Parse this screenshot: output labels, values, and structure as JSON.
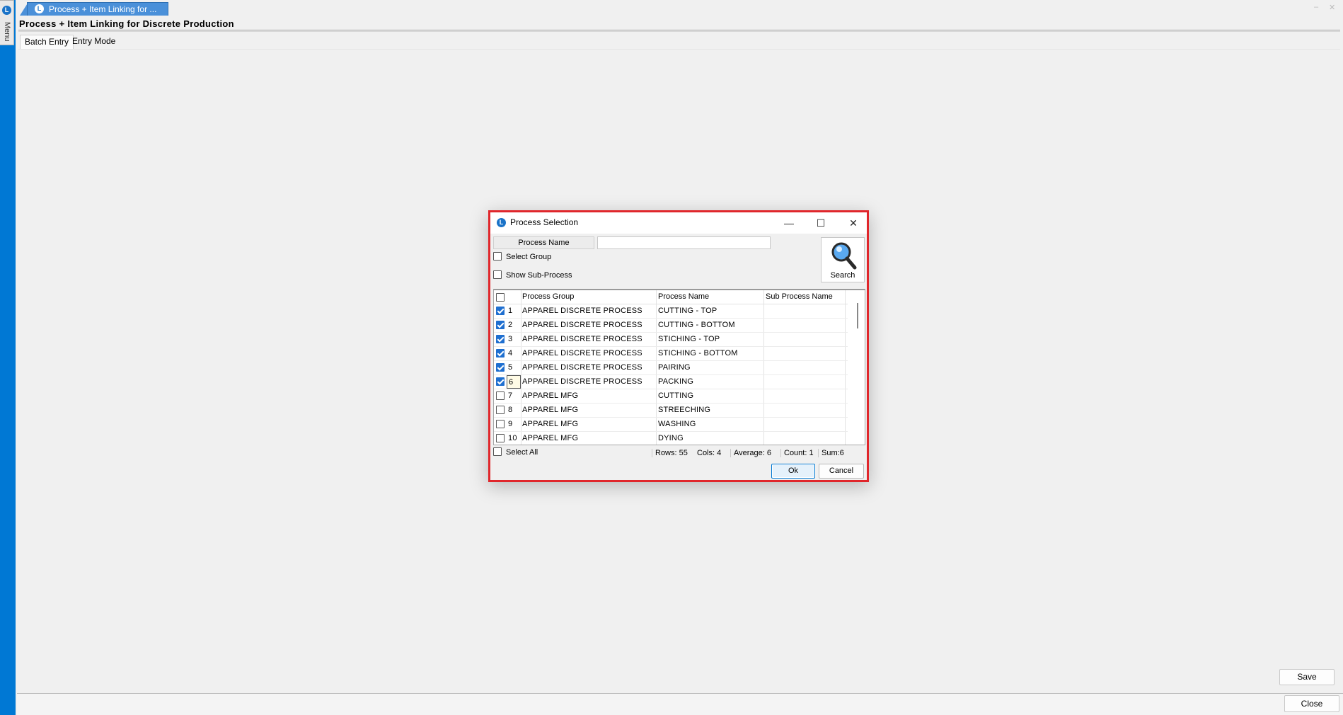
{
  "app": {
    "side_menu_label": "Menu",
    "logo_letter": "L",
    "doc_tab_title": "Process + Item Linking for ...",
    "page_title": "Process + Item Linking for Discrete Production",
    "window_controls": [
      "–",
      "✕"
    ]
  },
  "mode_tabs": [
    {
      "label": "Batch Entry",
      "active": true
    },
    {
      "label": "Entry Mode",
      "active": false
    }
  ],
  "buttons": {
    "save": "Save",
    "close": "Close"
  },
  "dialog": {
    "title": "Process Selection",
    "controls": {
      "minimize": "—",
      "maximize": "☐",
      "close": "✕"
    },
    "process_name_label": "Process Name",
    "process_name_value": "",
    "select_group_label": "Select Group",
    "select_group_checked": false,
    "show_subprocess_label": "Show Sub-Process",
    "show_subprocess_checked": false,
    "search_label": "Search",
    "grid": {
      "columns": [
        "Process Group",
        "Process Name",
        "Sub Process Name"
      ],
      "rows": [
        {
          "num": "1",
          "checked": true,
          "group": "APPAREL DISCRETE PROCESS",
          "process": "CUTTING - TOP",
          "sub": ""
        },
        {
          "num": "2",
          "checked": true,
          "group": "APPAREL DISCRETE PROCESS",
          "process": "CUTTING - BOTTOM",
          "sub": ""
        },
        {
          "num": "3",
          "checked": true,
          "group": "APPAREL DISCRETE PROCESS",
          "process": "STICHING - TOP",
          "sub": ""
        },
        {
          "num": "4",
          "checked": true,
          "group": "APPAREL DISCRETE PROCESS",
          "process": "STICHING - BOTTOM",
          "sub": ""
        },
        {
          "num": "5",
          "checked": true,
          "group": "APPAREL DISCRETE PROCESS",
          "process": "PAIRING",
          "sub": ""
        },
        {
          "num": "6",
          "checked": true,
          "group": "APPAREL DISCRETE PROCESS",
          "process": "PACKING",
          "sub": ""
        },
        {
          "num": "7",
          "checked": false,
          "group": "APPAREL MFG",
          "process": "CUTTING",
          "sub": ""
        },
        {
          "num": "8",
          "checked": false,
          "group": "APPAREL MFG",
          "process": "STREECHING",
          "sub": ""
        },
        {
          "num": "9",
          "checked": false,
          "group": "APPAREL MFG",
          "process": "WASHING",
          "sub": ""
        },
        {
          "num": "10",
          "checked": false,
          "group": "APPAREL MFG",
          "process": "DYING",
          "sub": ""
        }
      ]
    },
    "select_all_label": "Select All",
    "summary": {
      "rows": "Rows: 55",
      "cols": "Cols: 4",
      "average": "Average: 6",
      "count": "Count: 1",
      "sum": "Sum:6"
    },
    "ok_label": "Ok",
    "cancel_label": "Cancel"
  },
  "colors": {
    "accent": "#0078d4",
    "highlight_border": "#e0262b",
    "tab_blue": "#4a90d9"
  }
}
